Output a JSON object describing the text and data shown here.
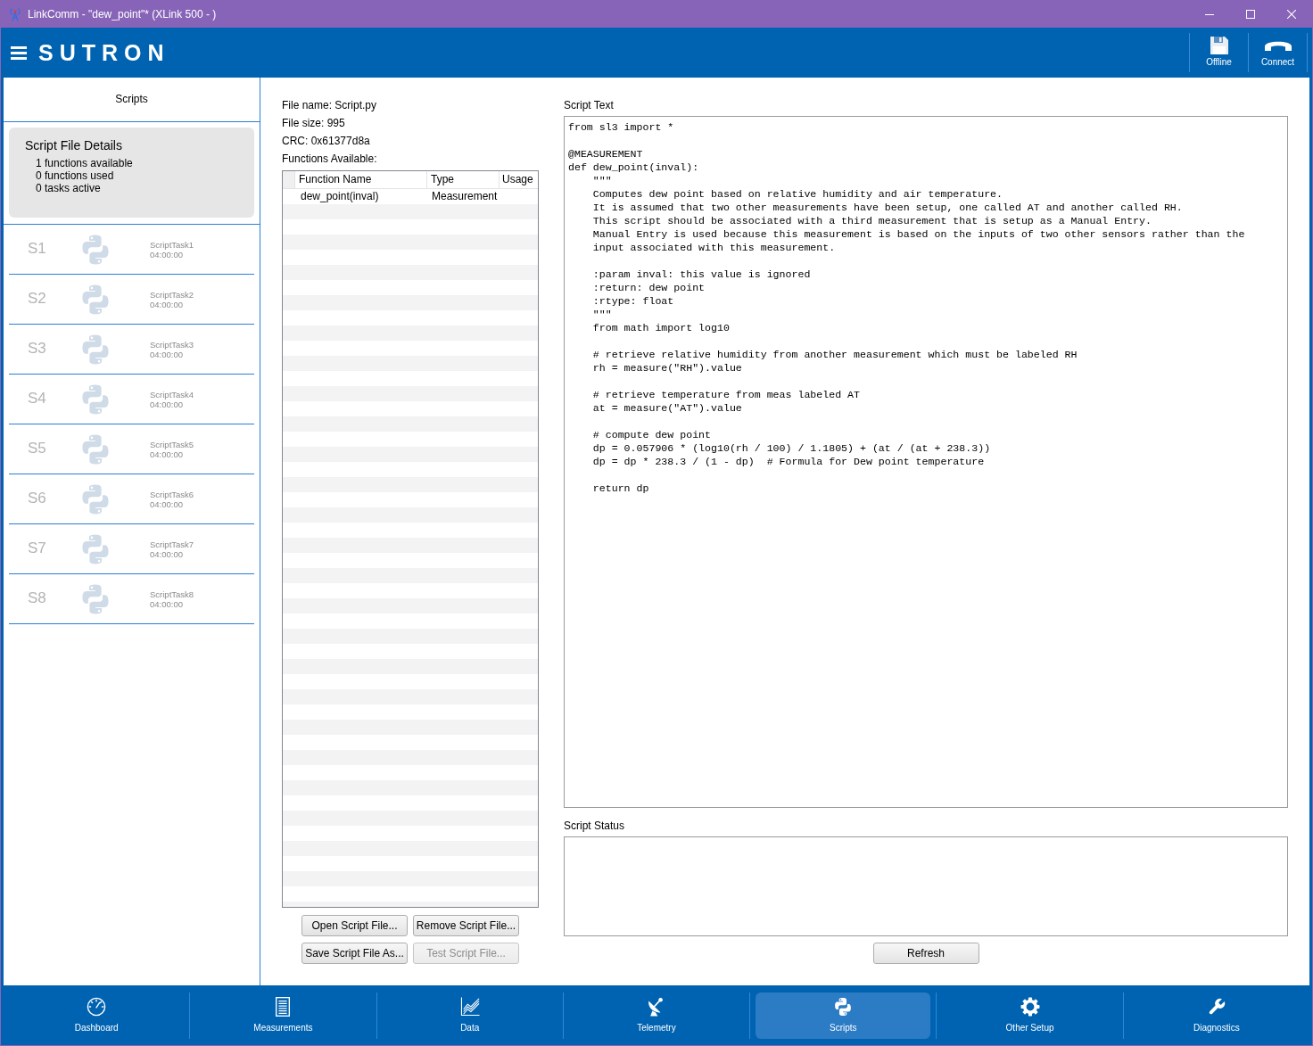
{
  "window": {
    "title": "LinkComm - \"dew_point\"* (XLink 500 - )"
  },
  "header": {
    "logo": "SUTRON",
    "actions": [
      {
        "kind": "save",
        "label": "Offline"
      },
      {
        "kind": "phone",
        "label": "Connect"
      }
    ]
  },
  "sidebar": {
    "title": "Scripts",
    "details": {
      "heading": "Script File Details",
      "lines": [
        "1 functions available",
        "0 functions used",
        "0 tasks active"
      ]
    },
    "slots": [
      {
        "label": "S1",
        "task": "ScriptTask1",
        "time": "04:00:00",
        "disabled": true
      },
      {
        "label": "S2",
        "task": "ScriptTask2",
        "time": "04:00:00",
        "disabled": true
      },
      {
        "label": "S3",
        "task": "ScriptTask3",
        "time": "04:00:00",
        "disabled": true
      },
      {
        "label": "S4",
        "task": "ScriptTask4",
        "time": "04:00:00",
        "disabled": true
      },
      {
        "label": "S5",
        "task": "ScriptTask5",
        "time": "04:00:00",
        "disabled": true
      },
      {
        "label": "S6",
        "task": "ScriptTask6",
        "time": "04:00:00",
        "disabled": true
      },
      {
        "label": "S7",
        "task": "ScriptTask7",
        "time": "04:00:00",
        "disabled": true
      },
      {
        "label": "S8",
        "task": "ScriptTask8",
        "time": "04:00:00",
        "disabled": true
      }
    ]
  },
  "file_info": {
    "lines": [
      "File name: Script.py",
      "File size: 995",
      "CRC: 0x61377d8a"
    ],
    "functions_label": "Functions Available:"
  },
  "functions_table": {
    "columns": [
      "Function Name",
      "Type",
      "Usage"
    ],
    "rows": [
      [
        "dew_point(inval)",
        "Measurement"
      ]
    ]
  },
  "file_buttons": [
    {
      "label": "Open Script File...",
      "disabled": false
    },
    {
      "label": "Remove Script File...",
      "disabled": false
    },
    {
      "label": "Save Script File As...",
      "disabled": false
    },
    {
      "label": "Test Script File...",
      "disabled": true
    }
  ],
  "script_text": {
    "label": "Script Text",
    "code": "from sl3 import *\n\n@MEASUREMENT\ndef dew_point(inval):\n    \"\"\"\n    Computes dew point based on relative humidity and air temperature.\n    It is assumed that two other measurements have been setup, one called AT and another called RH.\n    This script should be associated with a third measurement that is setup as a Manual Entry.\n    Manual Entry is used because this measurement is based on the inputs of two other sensors rather than the\n    input associated with this measurement.\n\n    :param inval: this value is ignored\n    :return: dew point\n    :rtype: float\n    \"\"\"\n    from math import log10\n\n    # retrieve relative humidity from another measurement which must be labeled RH\n    rh = measure(\"RH\").value\n\n    # retrieve temperature from meas labeled AT\n    at = measure(\"AT\").value\n\n    # compute dew point\n    dp = 0.057906 * (log10(rh / 100) / 1.1805) + (at / (at + 238.3))\n    dp = dp * 238.3 / (1 - dp)  # Formula for Dew point temperature\n\n    return dp"
  },
  "script_status": {
    "label": "Script Status"
  },
  "refresh_button": {
    "label": "Refresh"
  },
  "nav": [
    {
      "kind": "gauge",
      "label": "Dashboard",
      "selected": false
    },
    {
      "kind": "list",
      "label": "Measurements",
      "selected": false
    },
    {
      "kind": "chart",
      "label": "Data",
      "selected": false
    },
    {
      "kind": "dish",
      "label": "Telemetry",
      "selected": false
    },
    {
      "kind": "python",
      "label": "Scripts",
      "selected": true
    },
    {
      "kind": "gear",
      "label": "Other Setup",
      "selected": false
    },
    {
      "kind": "wrench",
      "label": "Diagnostics",
      "selected": false
    }
  ]
}
